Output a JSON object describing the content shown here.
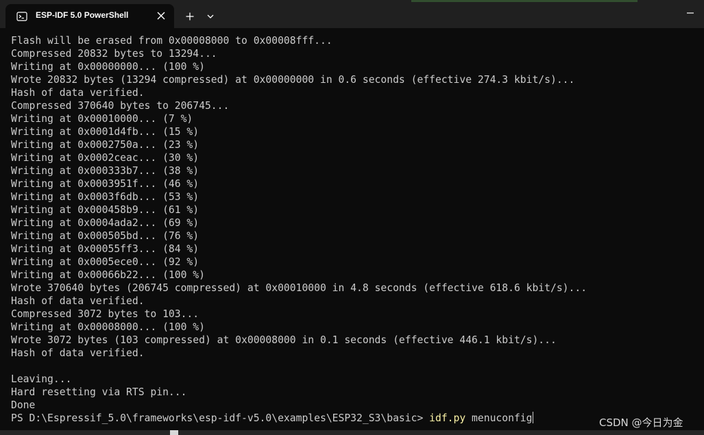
{
  "window": {
    "tab_title": "ESP-IDF 5.0 PowerShell"
  },
  "icons": {
    "tab": "terminal-icon",
    "close": "close-icon",
    "new_tab": "plus-icon",
    "dropdown": "chevron-down-icon",
    "minimize": "minimize-icon"
  },
  "colors": {
    "terminal_bg": "#0c0c0c",
    "text": "#cccccc",
    "command": "#f9f1a5",
    "titlebar": "#202020"
  },
  "terminal": {
    "lines": [
      "Flash will be erased from 0x00008000 to 0x00008fff...",
      "Compressed 20832 bytes to 13294...",
      "Writing at 0x00000000... (100 %)",
      "Wrote 20832 bytes (13294 compressed) at 0x00000000 in 0.6 seconds (effective 274.3 kbit/s)...",
      "Hash of data verified.",
      "Compressed 370640 bytes to 206745...",
      "Writing at 0x00010000... (7 %)",
      "Writing at 0x0001d4fb... (15 %)",
      "Writing at 0x0002750a... (23 %)",
      "Writing at 0x0002ceac... (30 %)",
      "Writing at 0x000333b7... (38 %)",
      "Writing at 0x0003951f... (46 %)",
      "Writing at 0x0003f6db... (53 %)",
      "Writing at 0x000458b9... (61 %)",
      "Writing at 0x0004ada2... (69 %)",
      "Writing at 0x000505bd... (76 %)",
      "Writing at 0x00055ff3... (84 %)",
      "Writing at 0x0005ece0... (92 %)",
      "Writing at 0x00066b22... (100 %)",
      "Wrote 370640 bytes (206745 compressed) at 0x00010000 in 4.8 seconds (effective 618.6 kbit/s)...",
      "Hash of data verified.",
      "Compressed 3072 bytes to 103...",
      "Writing at 0x00008000... (100 %)",
      "Wrote 3072 bytes (103 compressed) at 0x00008000 in 0.1 seconds (effective 446.1 kbit/s)...",
      "Hash of data verified.",
      "",
      "Leaving...",
      "Hard resetting via RTS pin...",
      "Done"
    ],
    "prompt": "PS D:\\Espressif_5.0\\frameworks\\esp-idf-v5.0\\examples\\ESP32_S3\\basic> ",
    "command": "idf.py",
    "args": " menuconfig"
  },
  "watermark": "CSDN @今日为金"
}
